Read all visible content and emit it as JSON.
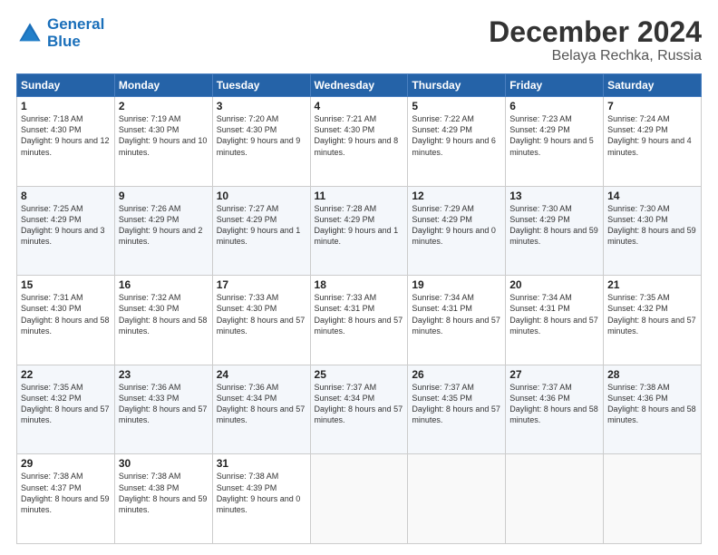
{
  "header": {
    "logo_line1": "General",
    "logo_line2": "Blue",
    "title": "December 2024",
    "subtitle": "Belaya Rechka, Russia"
  },
  "days_of_week": [
    "Sunday",
    "Monday",
    "Tuesday",
    "Wednesday",
    "Thursday",
    "Friday",
    "Saturday"
  ],
  "weeks": [
    [
      {
        "day": 1,
        "sunrise": "7:18 AM",
        "sunset": "4:30 PM",
        "daylight": "9 hours and 12 minutes."
      },
      {
        "day": 2,
        "sunrise": "7:19 AM",
        "sunset": "4:30 PM",
        "daylight": "9 hours and 10 minutes."
      },
      {
        "day": 3,
        "sunrise": "7:20 AM",
        "sunset": "4:30 PM",
        "daylight": "9 hours and 9 minutes."
      },
      {
        "day": 4,
        "sunrise": "7:21 AM",
        "sunset": "4:30 PM",
        "daylight": "9 hours and 8 minutes."
      },
      {
        "day": 5,
        "sunrise": "7:22 AM",
        "sunset": "4:29 PM",
        "daylight": "9 hours and 6 minutes."
      },
      {
        "day": 6,
        "sunrise": "7:23 AM",
        "sunset": "4:29 PM",
        "daylight": "9 hours and 5 minutes."
      },
      {
        "day": 7,
        "sunrise": "7:24 AM",
        "sunset": "4:29 PM",
        "daylight": "9 hours and 4 minutes."
      }
    ],
    [
      {
        "day": 8,
        "sunrise": "7:25 AM",
        "sunset": "4:29 PM",
        "daylight": "9 hours and 3 minutes."
      },
      {
        "day": 9,
        "sunrise": "7:26 AM",
        "sunset": "4:29 PM",
        "daylight": "9 hours and 2 minutes."
      },
      {
        "day": 10,
        "sunrise": "7:27 AM",
        "sunset": "4:29 PM",
        "daylight": "9 hours and 1 minutes."
      },
      {
        "day": 11,
        "sunrise": "7:28 AM",
        "sunset": "4:29 PM",
        "daylight": "9 hours and 1 minute."
      },
      {
        "day": 12,
        "sunrise": "7:29 AM",
        "sunset": "4:29 PM",
        "daylight": "9 hours and 0 minutes."
      },
      {
        "day": 13,
        "sunrise": "7:30 AM",
        "sunset": "4:29 PM",
        "daylight": "8 hours and 59 minutes."
      },
      {
        "day": 14,
        "sunrise": "7:30 AM",
        "sunset": "4:30 PM",
        "daylight": "8 hours and 59 minutes."
      }
    ],
    [
      {
        "day": 15,
        "sunrise": "7:31 AM",
        "sunset": "4:30 PM",
        "daylight": "8 hours and 58 minutes."
      },
      {
        "day": 16,
        "sunrise": "7:32 AM",
        "sunset": "4:30 PM",
        "daylight": "8 hours and 58 minutes."
      },
      {
        "day": 17,
        "sunrise": "7:33 AM",
        "sunset": "4:30 PM",
        "daylight": "8 hours and 57 minutes."
      },
      {
        "day": 18,
        "sunrise": "7:33 AM",
        "sunset": "4:31 PM",
        "daylight": "8 hours and 57 minutes."
      },
      {
        "day": 19,
        "sunrise": "7:34 AM",
        "sunset": "4:31 PM",
        "daylight": "8 hours and 57 minutes."
      },
      {
        "day": 20,
        "sunrise": "7:34 AM",
        "sunset": "4:31 PM",
        "daylight": "8 hours and 57 minutes."
      },
      {
        "day": 21,
        "sunrise": "7:35 AM",
        "sunset": "4:32 PM",
        "daylight": "8 hours and 57 minutes."
      }
    ],
    [
      {
        "day": 22,
        "sunrise": "7:35 AM",
        "sunset": "4:32 PM",
        "daylight": "8 hours and 57 minutes."
      },
      {
        "day": 23,
        "sunrise": "7:36 AM",
        "sunset": "4:33 PM",
        "daylight": "8 hours and 57 minutes."
      },
      {
        "day": 24,
        "sunrise": "7:36 AM",
        "sunset": "4:34 PM",
        "daylight": "8 hours and 57 minutes."
      },
      {
        "day": 25,
        "sunrise": "7:37 AM",
        "sunset": "4:34 PM",
        "daylight": "8 hours and 57 minutes."
      },
      {
        "day": 26,
        "sunrise": "7:37 AM",
        "sunset": "4:35 PM",
        "daylight": "8 hours and 57 minutes."
      },
      {
        "day": 27,
        "sunrise": "7:37 AM",
        "sunset": "4:36 PM",
        "daylight": "8 hours and 58 minutes."
      },
      {
        "day": 28,
        "sunrise": "7:38 AM",
        "sunset": "4:36 PM",
        "daylight": "8 hours and 58 minutes."
      }
    ],
    [
      {
        "day": 29,
        "sunrise": "7:38 AM",
        "sunset": "4:37 PM",
        "daylight": "8 hours and 59 minutes."
      },
      {
        "day": 30,
        "sunrise": "7:38 AM",
        "sunset": "4:38 PM",
        "daylight": "8 hours and 59 minutes."
      },
      {
        "day": 31,
        "sunrise": "7:38 AM",
        "sunset": "4:39 PM",
        "daylight": "9 hours and 0 minutes."
      },
      null,
      null,
      null,
      null
    ]
  ]
}
